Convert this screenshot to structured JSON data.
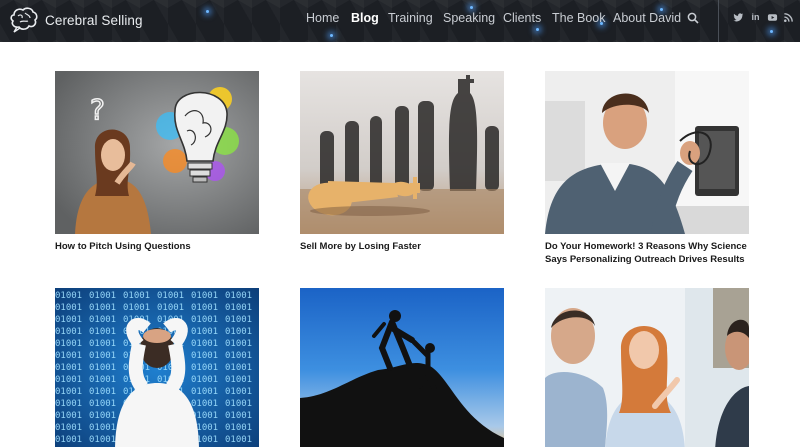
{
  "brand": {
    "name": "Cerebral Selling"
  },
  "nav": {
    "items": [
      {
        "label": "Home",
        "active": false
      },
      {
        "label": "Blog",
        "active": true
      },
      {
        "label": "Training",
        "active": false
      },
      {
        "label": "Speaking",
        "active": false
      },
      {
        "label": "Clients",
        "active": false
      },
      {
        "label": "The Book",
        "active": false
      },
      {
        "label": "About David",
        "active": false
      }
    ],
    "search_icon": "search-icon"
  },
  "social": [
    {
      "icon": "twitter-icon",
      "glyph": "t"
    },
    {
      "icon": "linkedin-icon",
      "glyph": "in"
    },
    {
      "icon": "youtube-icon",
      "glyph": "▶"
    },
    {
      "icon": "rss-icon",
      "glyph": "◔"
    }
  ],
  "posts": [
    {
      "title": "How to Pitch Using Questions",
      "image": "woman-lightbulb-doodle"
    },
    {
      "title": "Sell More by Losing Faster",
      "image": "fallen-chess-king"
    },
    {
      "title": "Do Your Homework! 3 Reasons Why Science Says Personalizing Outreach Drives Results",
      "image": "man-at-computer"
    },
    {
      "title": "",
      "image": "man-binary-wall"
    },
    {
      "title": "",
      "image": "climbers-silhouette"
    },
    {
      "title": "",
      "image": "business-meeting"
    }
  ],
  "colors": {
    "header_bg": "#1c1f24",
    "nav_text": "#c9cdd3",
    "nav_active": "#ffffff",
    "caption_text": "#1a1a1a"
  }
}
